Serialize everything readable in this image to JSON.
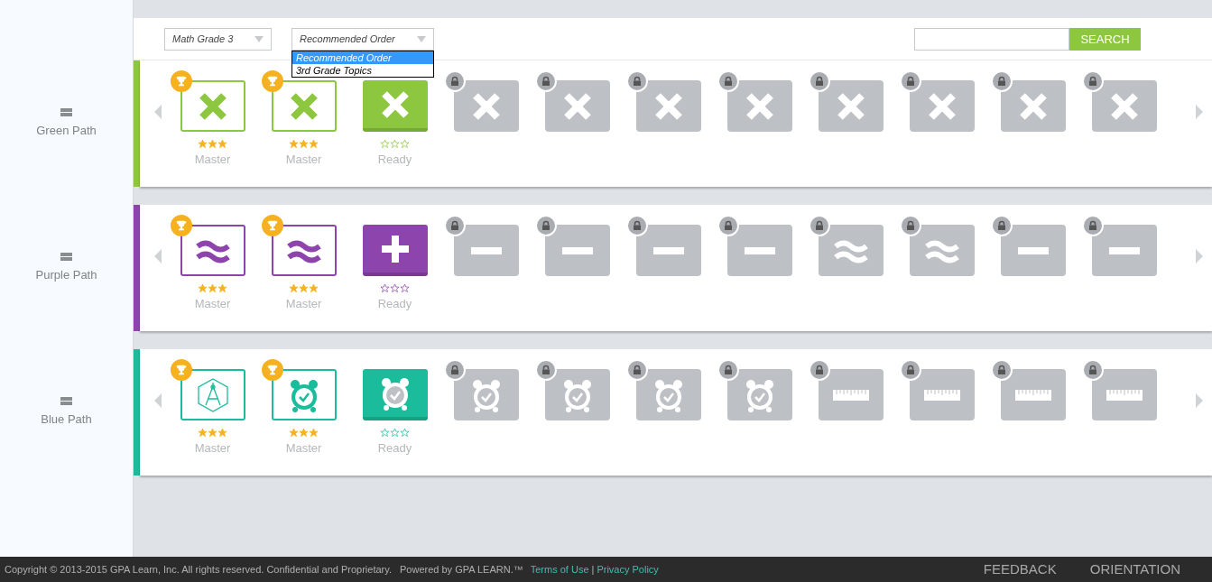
{
  "filters": {
    "subject": {
      "value": "Math Grade 3"
    },
    "order": {
      "value": "Recommended Order",
      "expanded": true,
      "options": [
        {
          "label": "Recommended Order",
          "selected": true
        },
        {
          "label": "3rd Grade Topics",
          "selected": false
        }
      ]
    }
  },
  "search": {
    "button": "SEARCH"
  },
  "paths": [
    {
      "name": "Green Path",
      "color": "#8dc63f",
      "tiles": [
        {
          "kind": "times",
          "locked": false,
          "mastered": true,
          "stars": 3,
          "label": "Master"
        },
        {
          "kind": "times",
          "locked": false,
          "mastered": true,
          "stars": 3,
          "label": "Master"
        },
        {
          "kind": "times",
          "locked": false,
          "mastered": false,
          "stars": 0,
          "label": "Ready"
        },
        {
          "kind": "times",
          "locked": true,
          "mastered": false
        },
        {
          "kind": "times",
          "locked": true,
          "mastered": false
        },
        {
          "kind": "times",
          "locked": true,
          "mastered": false
        },
        {
          "kind": "times",
          "locked": true,
          "mastered": false
        },
        {
          "kind": "times",
          "locked": true,
          "mastered": false
        },
        {
          "kind": "times",
          "locked": true,
          "mastered": false
        },
        {
          "kind": "times",
          "locked": true,
          "mastered": false
        },
        {
          "kind": "times",
          "locked": true,
          "mastered": false
        }
      ]
    },
    {
      "name": "Purple Path",
      "color": "#8e44ad",
      "tiles": [
        {
          "kind": "approx",
          "locked": false,
          "mastered": true,
          "stars": 3,
          "label": "Master"
        },
        {
          "kind": "approx",
          "locked": false,
          "mastered": true,
          "stars": 3,
          "label": "Master"
        },
        {
          "kind": "plus",
          "locked": false,
          "mastered": false,
          "stars": 0,
          "label": "Ready"
        },
        {
          "kind": "minus",
          "locked": true,
          "mastered": false
        },
        {
          "kind": "minus",
          "locked": true,
          "mastered": false
        },
        {
          "kind": "minus",
          "locked": true,
          "mastered": false
        },
        {
          "kind": "minus",
          "locked": true,
          "mastered": false
        },
        {
          "kind": "approx",
          "locked": true,
          "mastered": false
        },
        {
          "kind": "approx",
          "locked": true,
          "mastered": false
        },
        {
          "kind": "minus",
          "locked": true,
          "mastered": false
        },
        {
          "kind": "minus",
          "locked": true,
          "mastered": false
        }
      ]
    },
    {
      "name": "Blue Path",
      "color": "#1abc9c",
      "tiles": [
        {
          "kind": "compass",
          "locked": false,
          "mastered": true,
          "stars": 3,
          "label": "Master"
        },
        {
          "kind": "clock",
          "locked": false,
          "mastered": true,
          "stars": 3,
          "label": "Master"
        },
        {
          "kind": "clock",
          "locked": false,
          "mastered": false,
          "stars": 0,
          "label": "Ready"
        },
        {
          "kind": "clock",
          "locked": true,
          "mastered": false
        },
        {
          "kind": "clock",
          "locked": true,
          "mastered": false
        },
        {
          "kind": "clock",
          "locked": true,
          "mastered": false
        },
        {
          "kind": "clock",
          "locked": true,
          "mastered": false
        },
        {
          "kind": "ruler",
          "locked": true,
          "mastered": false
        },
        {
          "kind": "ruler",
          "locked": true,
          "mastered": false
        },
        {
          "kind": "ruler",
          "locked": true,
          "mastered": false
        },
        {
          "kind": "ruler",
          "locked": true,
          "mastered": false
        }
      ]
    }
  ],
  "footer": {
    "copyright": "Copyright © 2013-2015 GPA Learn, Inc. All rights reserved. Confidential and Proprietary.",
    "powered": "Powered by GPA LEARN.™",
    "links": [
      "Terms of Use",
      "Privacy Policy"
    ],
    "separator": "|",
    "nav": [
      "FEEDBACK",
      "ORIENTATION"
    ]
  }
}
